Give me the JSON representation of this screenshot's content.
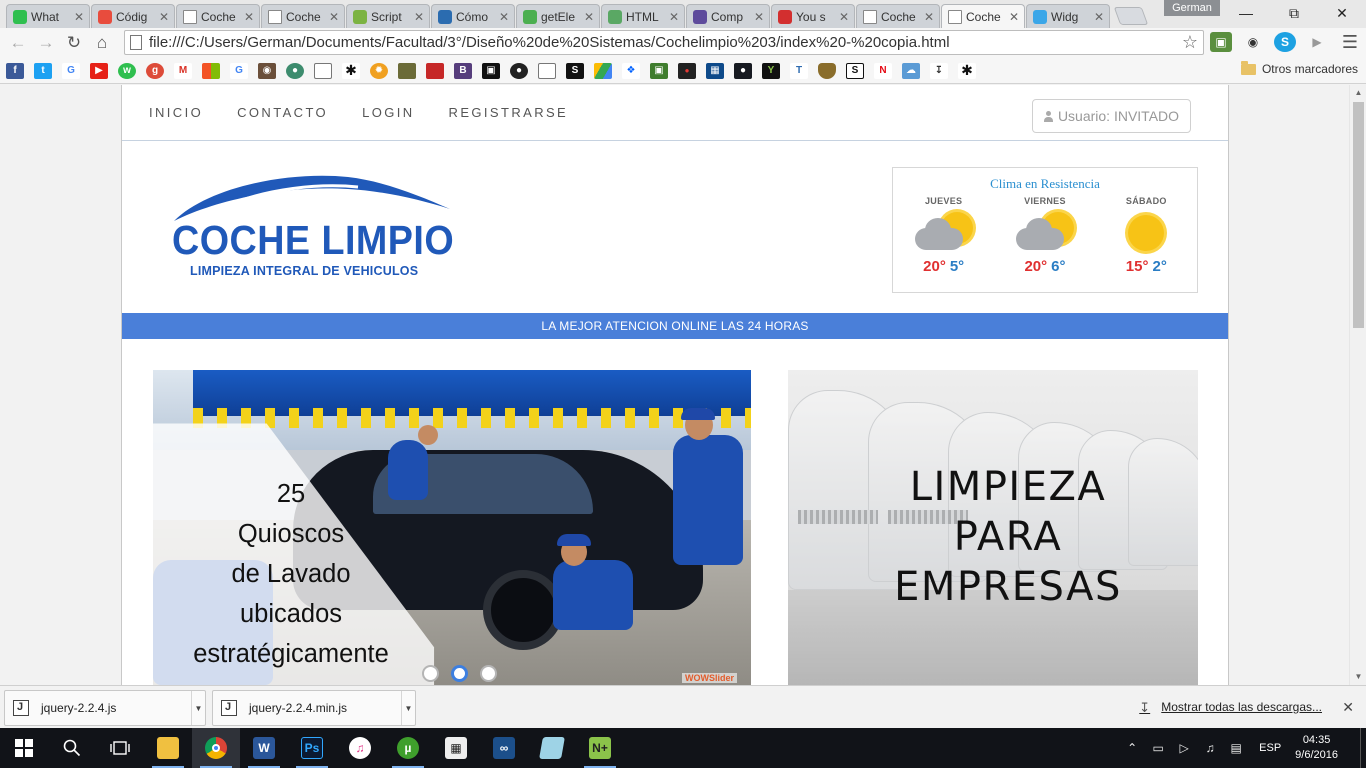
{
  "browser": {
    "tabs": [
      {
        "title": "What",
        "favicon_color": "#2fbf4f"
      },
      {
        "title": "Códig",
        "favicon_color": "#e84c3d"
      },
      {
        "title": "Coche",
        "favicon_color": "#ffffff"
      },
      {
        "title": "Coche",
        "favicon_color": "#ffffff"
      },
      {
        "title": "Script",
        "favicon_color": "#7cb342"
      },
      {
        "title": "Cómo",
        "favicon_color": "#2b6cb0"
      },
      {
        "title": "getEle",
        "favicon_color": "#4caf50"
      },
      {
        "title": "HTML",
        "favicon_color": "#5aa864"
      },
      {
        "title": "Comp",
        "favicon_color": "#5e4b9c"
      },
      {
        "title": "You s",
        "favicon_color": "#d32f2f"
      },
      {
        "title": "Coche",
        "favicon_color": "#ffffff"
      },
      {
        "title": "Coche",
        "favicon_color": "#ffffff",
        "active": true
      },
      {
        "title": "Widg",
        "favicon_color": "#3aa6e8"
      }
    ],
    "profile_name": "German",
    "url": "file:///C:/Users/German/Documents/Facultad/3°/Diseño%20de%20Sistemas/Cochelimpio%203/index%20-%20copia.html",
    "other_bookmarks": "Otros marcadores"
  },
  "site": {
    "nav": [
      "INICIO",
      "CONTACTO",
      "LOGIN",
      "REGISTRARSE"
    ],
    "user_label": "Usuario: INVITADO",
    "logo": {
      "title": "COCHE LIMPIO",
      "subtitle": "LIMPIEZA INTEGRAL DE VEHICULOS",
      "color": "#2059b9"
    },
    "weather": {
      "title": "Clima en Resistencia",
      "days": [
        {
          "name": "JUEVES",
          "icon": "partly-cloudy-icon",
          "max": "20°",
          "min": "5°"
        },
        {
          "name": "VIERNES",
          "icon": "partly-cloudy-icon",
          "max": "20°",
          "min": "6°"
        },
        {
          "name": "SÁBADO",
          "icon": "sunny-icon",
          "max": "15°",
          "min": "2°"
        }
      ]
    },
    "banner": "LA MEJOR ATENCION ONLINE LAS 24 HORAS",
    "banner_color": "#4a7fd9",
    "slider": {
      "caption_lines": [
        "25",
        "Quioscos",
        "de Lavado",
        "ubicados",
        "estratégicamente"
      ],
      "dots": 3,
      "active_dot": 2,
      "watermark": "WOWSlider"
    },
    "promo": {
      "lines": [
        "LIMPIEZA",
        "PARA",
        "EMPRESAS"
      ]
    }
  },
  "downloads": {
    "items": [
      "jquery-2.2.4.js",
      "jquery-2.2.4.min.js"
    ],
    "show_all": "Mostrar todas las descargas..."
  },
  "taskbar": {
    "apps": [
      "file-explorer-icon",
      "chrome-icon",
      "word-icon",
      "photoshop-icon",
      "itunes-icon",
      "utorrent-icon",
      "calculator-icon",
      "visual-studio-icon",
      "notes-icon",
      "notepad-plus-plus-icon"
    ],
    "language": "ESP",
    "time": "04:35",
    "date": "9/6/2016"
  }
}
